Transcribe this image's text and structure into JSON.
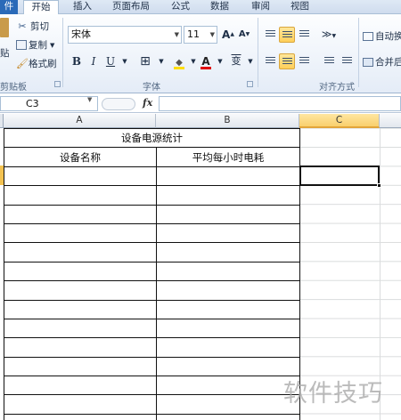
{
  "ribbon": {
    "tabs": [
      "件",
      "开始",
      "插入",
      "页面布局",
      "公式",
      "数据",
      "审阅",
      "视图"
    ],
    "clipboard": {
      "paste": "贴",
      "cut": "剪切",
      "copy": "复制",
      "format_painter": "格式刷",
      "group": "剪贴板"
    },
    "font": {
      "name": "宋体",
      "size": "11",
      "bold": "B",
      "italic": "I",
      "underline": "U",
      "grow": "A",
      "shrink": "A",
      "phonetic": "变",
      "group": "字体"
    },
    "alignment": {
      "wrap": "自动换",
      "merge": "合并后",
      "group": "对齐方式"
    }
  },
  "formula_bar": {
    "name_box": "C3",
    "fx": "fx",
    "content": ""
  },
  "sheet": {
    "columns": [
      "A",
      "B",
      "C"
    ],
    "title": "设备电源统计",
    "headers": [
      "设备名称",
      "平均每小时电耗"
    ]
  },
  "watermark": "软件技巧"
}
